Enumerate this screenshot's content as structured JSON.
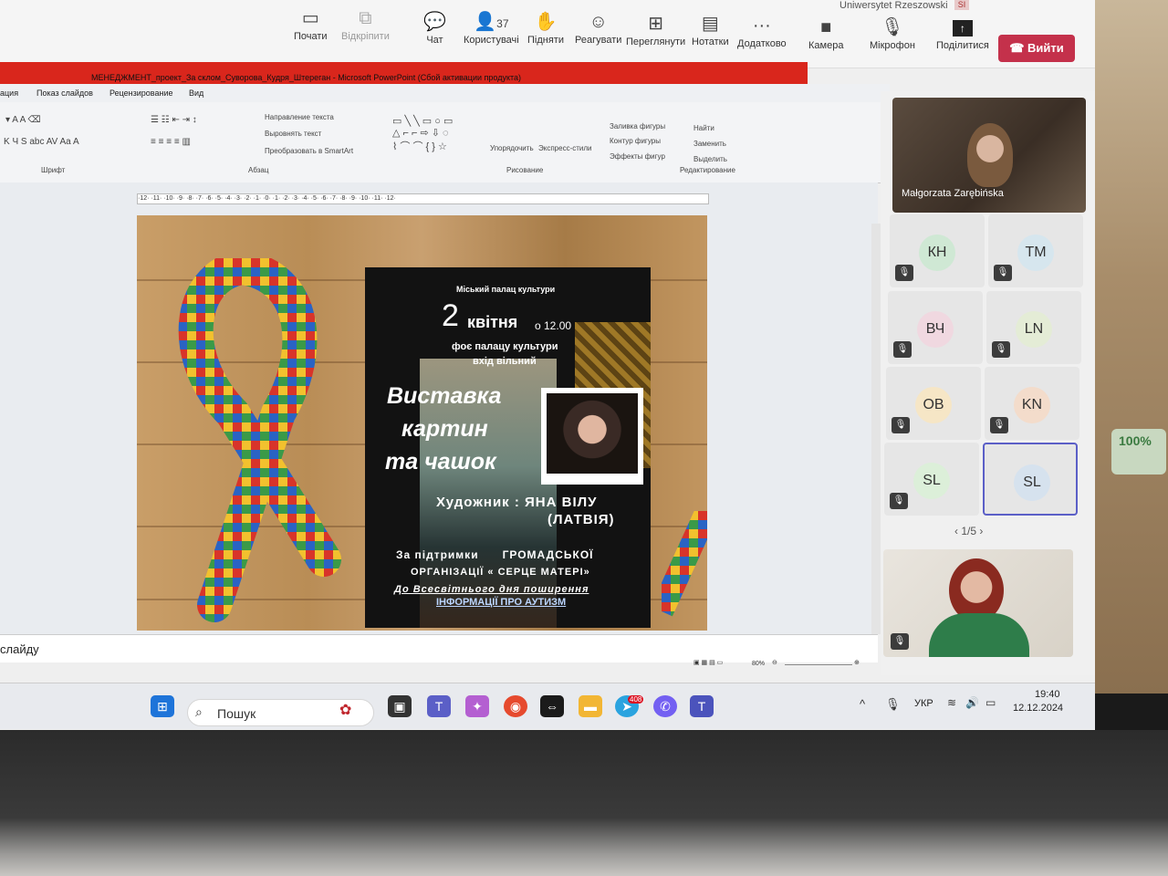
{
  "teams": {
    "host": "Uniwersytet Rzeszowski",
    "host_badge": "SI",
    "buttons": [
      {
        "label": "Почати",
        "icon": "share-screen-icon"
      },
      {
        "label": "Відкріпити",
        "icon": "unpin-icon"
      },
      {
        "label": "Чат",
        "icon": "chat-icon"
      },
      {
        "label": "Користувачі",
        "icon": "people-icon",
        "count": "37"
      },
      {
        "label": "Підняти",
        "icon": "raise-hand-icon"
      },
      {
        "label": "Реагувати",
        "icon": "react-icon"
      },
      {
        "label": "Переглянути",
        "icon": "view-icon"
      },
      {
        "label": "Нотатки",
        "icon": "notes-icon"
      },
      {
        "label": "Додатково",
        "icon": "more-icon"
      },
      {
        "label": "Камера",
        "icon": "camera-icon"
      },
      {
        "label": "Мікрофон",
        "icon": "microphone-icon"
      },
      {
        "label": "Поділитися",
        "icon": "share-icon"
      }
    ],
    "leave": "Вийти",
    "speaker": "Małgorzata Zarębińska",
    "participants": [
      "КН",
      "ТМ",
      "ВЧ",
      "LN",
      "ОВ",
      "KN",
      "SL",
      "SL"
    ],
    "pager": "1/5"
  },
  "ppt": {
    "title": "МЕНЕДЖМЕНТ_проект_За склом_Суворова_Кудря_Штереган - Microsoft PowerPoint (Сбой активации продукта)",
    "menu": [
      "ация",
      "Показ слайдов",
      "Рецензирование",
      "Вид"
    ],
    "ribbon": {
      "groups": [
        "Шрифт",
        "Абзац",
        "Рисование",
        "Редактирование"
      ],
      "text_direction": "Направление текста",
      "align_text": "Выровнять текст",
      "smartart": "Преобразовать в SmartArt",
      "arrange": "Упорядочить",
      "quick_styles": "Экспресс-стили",
      "shape_fill": "Заливка фигуры",
      "shape_outline": "Контур фигуры",
      "shape_effects": "Эффекты фигур",
      "find": "Найти",
      "replace": "Заменить",
      "select": "Выделить"
    },
    "ruler": "·12· ·11· ·10· ·9· ·8· ·7· ·6· ·5· ·4· ·3· ·2· ·1· ·0· ·1· ·2· ·3· ·4· ·5· ·6· ·7· ·8· ·9· ·10· ·11· ·12·",
    "notes": "слайду",
    "zoom": "80%"
  },
  "poster": {
    "venue": "Міський палац культури",
    "day": "2",
    "month": "квітня",
    "time": "о 12.00",
    "place": "фоє палацу культури",
    "entry": "вхід вільний",
    "title1": "Виставка",
    "title2": "картин",
    "title3": "та чашок",
    "artist_line1": "Художник : ЯНА ВІЛУ",
    "artist_line2": "(ЛАТВІЯ)",
    "support1": "За підтримки      ГРОМАДСЬКОЇ",
    "support2": "ОРГАНІЗАЦІЇ « СЕРЦЕ МАТЕРІ»",
    "day_line1": "До Всесвітнього дня поширення",
    "day_line2": "ІНФОРМАЦІЇ ПРО АУТИЗМ"
  },
  "taskbar": {
    "search": "Пошук",
    "badge": "408",
    "lang": "УКР",
    "time": "19:40",
    "date": "12.12.2024"
  },
  "environment": {
    "sticker": "100%"
  }
}
